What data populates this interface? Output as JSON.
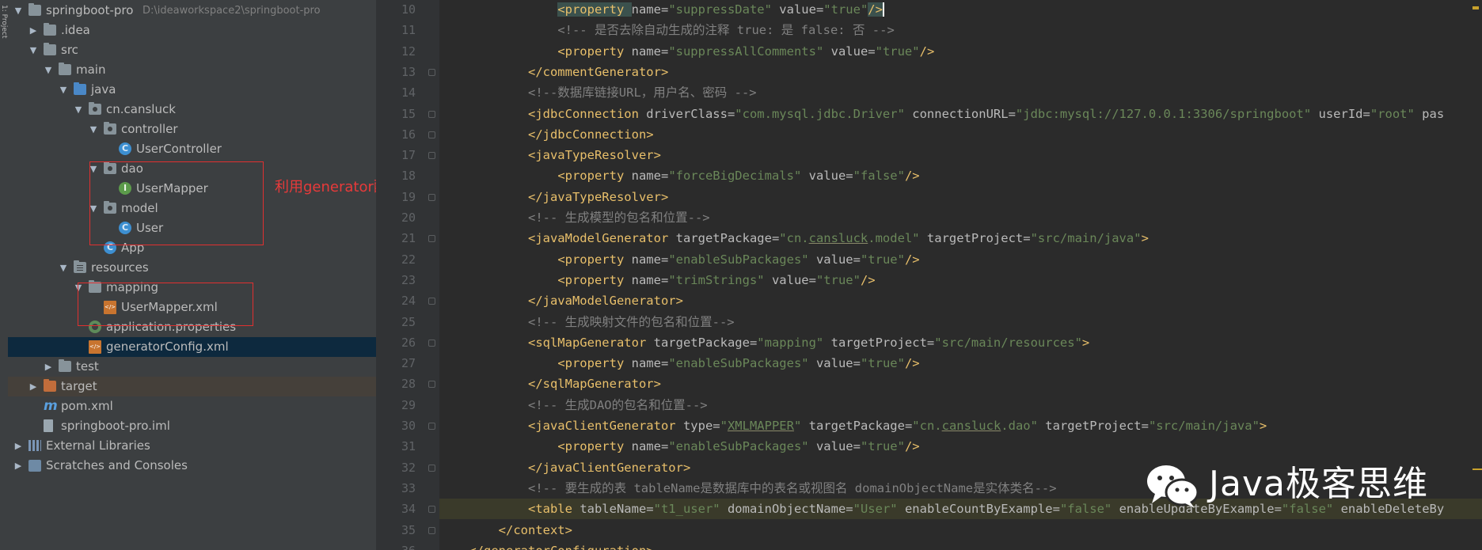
{
  "left_tool_tab": "1: Project",
  "project_tree": [
    {
      "label": "springboot-pro",
      "path": "D:\\ideaworkspace2\\springboot-pro",
      "icon": "project-folder-icon",
      "expanded": true
    },
    {
      "label": ".idea",
      "icon": "folder-icon",
      "expanded": false
    },
    {
      "label": "src",
      "icon": "folder-icon",
      "expanded": true
    },
    {
      "label": "main",
      "icon": "folder-icon",
      "expanded": true
    },
    {
      "label": "java",
      "icon": "source-folder-icon",
      "expanded": true
    },
    {
      "label": "cn.cansluck",
      "icon": "package-icon",
      "expanded": true
    },
    {
      "label": "controller",
      "icon": "package-icon",
      "expanded": true
    },
    {
      "label": "UserController",
      "icon": "class-icon"
    },
    {
      "label": "dao",
      "icon": "package-icon",
      "expanded": true
    },
    {
      "label": "UserMapper",
      "icon": "interface-icon"
    },
    {
      "label": "model",
      "icon": "package-icon",
      "expanded": true
    },
    {
      "label": "User",
      "icon": "class-icon"
    },
    {
      "label": "App",
      "icon": "springboot-class-icon"
    },
    {
      "label": "resources",
      "icon": "resources-folder-icon",
      "expanded": true
    },
    {
      "label": "mapping",
      "icon": "folder-icon",
      "expanded": true
    },
    {
      "label": "UserMapper.xml",
      "icon": "xml-file-icon"
    },
    {
      "label": "application.properties",
      "icon": "properties-file-icon"
    },
    {
      "label": "generatorConfig.xml",
      "icon": "xml-file-icon",
      "selected": true
    },
    {
      "label": "test",
      "icon": "folder-icon",
      "expanded": false
    },
    {
      "label": "target",
      "icon": "excluded-folder-icon",
      "expanded": false
    },
    {
      "label": "pom.xml",
      "icon": "maven-icon"
    },
    {
      "label": "springboot-pro.iml",
      "icon": "iml-file-icon"
    },
    {
      "label": "External Libraries",
      "icon": "library-icon",
      "expanded": false
    },
    {
      "label": "Scratches and Consoles",
      "icon": "scratches-icon",
      "expanded": false
    }
  ],
  "annotation": "利用generator配置反向生成",
  "line_numbers": [
    "10",
    "11",
    "12",
    "13",
    "14",
    "15",
    "16",
    "17",
    "18",
    "19",
    "20",
    "21",
    "22",
    "23",
    "24",
    "25",
    "26",
    "27",
    "28",
    "29",
    "30",
    "31",
    "32",
    "33",
    "34",
    "35",
    "36"
  ],
  "code_lines": [
    [
      [
        "",
        "                "
      ],
      [
        "tagbox",
        "<property "
      ],
      [
        "attr",
        "name="
      ],
      [
        "val",
        "\"suppressDate\""
      ],
      [
        "attr",
        " value="
      ],
      [
        "val",
        "\"true\""
      ],
      [
        "tagbox",
        "/>"
      ]
    ],
    [
      [
        "",
        "                "
      ],
      [
        "cmt",
        "<!-- 是否去除自动生成的注释 true: 是 false: 否 -->"
      ]
    ],
    [
      [
        "",
        "                "
      ],
      [
        "tag",
        "<property "
      ],
      [
        "attr",
        "name="
      ],
      [
        "val",
        "\"suppressAllComments\""
      ],
      [
        "attr",
        " value="
      ],
      [
        "val",
        "\"true\""
      ],
      [
        "tag",
        "/>"
      ]
    ],
    [
      [
        "",
        "            "
      ],
      [
        "tag",
        "</commentGenerator>"
      ]
    ],
    [
      [
        "",
        "            "
      ],
      [
        "cmt",
        "<!--数据库链接URL，用户名、密码 -->"
      ]
    ],
    [
      [
        "",
        "            "
      ],
      [
        "tag",
        "<jdbcConnection "
      ],
      [
        "attr",
        "driverClass="
      ],
      [
        "val",
        "\"com.mysql.jdbc.Driver\""
      ],
      [
        "attr",
        " connectionURL="
      ],
      [
        "val",
        "\"jdbc:mysql://127.0.0.1:3306/springboot\""
      ],
      [
        "attr",
        " userId="
      ],
      [
        "val",
        "\"root\""
      ],
      [
        "attr",
        " pas"
      ]
    ],
    [
      [
        "",
        "            "
      ],
      [
        "tag",
        "</jdbcConnection>"
      ]
    ],
    [
      [
        "",
        "            "
      ],
      [
        "tag",
        "<javaTypeResolver>"
      ]
    ],
    [
      [
        "",
        "                "
      ],
      [
        "tag",
        "<property "
      ],
      [
        "attr",
        "name="
      ],
      [
        "val",
        "\"forceBigDecimals\""
      ],
      [
        "attr",
        " value="
      ],
      [
        "val",
        "\"false\""
      ],
      [
        "tag",
        "/>"
      ]
    ],
    [
      [
        "",
        "            "
      ],
      [
        "tag",
        "</javaTypeResolver>"
      ]
    ],
    [
      [
        "",
        "            "
      ],
      [
        "cmt",
        "<!-- 生成模型的包名和位置-->"
      ]
    ],
    [
      [
        "",
        "            "
      ],
      [
        "tag",
        "<javaModelGenerator "
      ],
      [
        "attr",
        "targetPackage="
      ],
      [
        "val",
        "\"cn."
      ],
      [
        "val ul",
        "cansluck"
      ],
      [
        "val",
        ".model\""
      ],
      [
        "attr",
        " targetProject="
      ],
      [
        "val",
        "\"src/main/java\""
      ],
      [
        "tag",
        ">"
      ]
    ],
    [
      [
        "",
        "                "
      ],
      [
        "tag",
        "<property "
      ],
      [
        "attr",
        "name="
      ],
      [
        "val",
        "\"enableSubPackages\""
      ],
      [
        "attr",
        " value="
      ],
      [
        "val",
        "\"true\""
      ],
      [
        "tag",
        "/>"
      ]
    ],
    [
      [
        "",
        "                "
      ],
      [
        "tag",
        "<property "
      ],
      [
        "attr",
        "name="
      ],
      [
        "val",
        "\"trimStrings\""
      ],
      [
        "attr",
        " value="
      ],
      [
        "val",
        "\"true\""
      ],
      [
        "tag",
        "/>"
      ]
    ],
    [
      [
        "",
        "            "
      ],
      [
        "tag",
        "</javaModelGenerator>"
      ]
    ],
    [
      [
        "",
        "            "
      ],
      [
        "cmt",
        "<!-- 生成映射文件的包名和位置-->"
      ]
    ],
    [
      [
        "",
        "            "
      ],
      [
        "tag",
        "<sqlMapGenerator "
      ],
      [
        "attr",
        "targetPackage="
      ],
      [
        "val",
        "\"mapping\""
      ],
      [
        "attr",
        " targetProject="
      ],
      [
        "val",
        "\"src/main/resources\""
      ],
      [
        "tag",
        ">"
      ]
    ],
    [
      [
        "",
        "                "
      ],
      [
        "tag",
        "<property "
      ],
      [
        "attr",
        "name="
      ],
      [
        "val",
        "\"enableSubPackages\""
      ],
      [
        "attr",
        " value="
      ],
      [
        "val",
        "\"true\""
      ],
      [
        "tag",
        "/>"
      ]
    ],
    [
      [
        "",
        "            "
      ],
      [
        "tag",
        "</sqlMapGenerator>"
      ]
    ],
    [
      [
        "",
        "            "
      ],
      [
        "cmt",
        "<!-- 生成DAO的包名和位置-->"
      ]
    ],
    [
      [
        "",
        "            "
      ],
      [
        "tag",
        "<javaClientGenerator "
      ],
      [
        "attr",
        "type="
      ],
      [
        "val",
        "\""
      ],
      [
        "val ul",
        "XMLMAPPER"
      ],
      [
        "val",
        "\""
      ],
      [
        "attr",
        " targetPackage="
      ],
      [
        "val",
        "\"cn."
      ],
      [
        "val ul",
        "cansluck"
      ],
      [
        "val",
        ".dao\""
      ],
      [
        "attr",
        " targetProject="
      ],
      [
        "val",
        "\"src/main/java\""
      ],
      [
        "tag",
        ">"
      ]
    ],
    [
      [
        "",
        "                "
      ],
      [
        "tag",
        "<property "
      ],
      [
        "attr",
        "name="
      ],
      [
        "val",
        "\"enableSubPackages\""
      ],
      [
        "attr",
        " value="
      ],
      [
        "val",
        "\"true\""
      ],
      [
        "tag",
        "/>"
      ]
    ],
    [
      [
        "",
        "            "
      ],
      [
        "tag",
        "</javaClientGenerator>"
      ]
    ],
    [
      [
        "",
        "            "
      ],
      [
        "cmt",
        "<!-- 要生成的表 tableName是数据库中的表名或视图名 domainObjectName是实体类名-->"
      ]
    ],
    [
      [
        "",
        "            "
      ],
      [
        "tag",
        "<table "
      ],
      [
        "attr",
        "tableName="
      ],
      [
        "val",
        "\"t1_user\""
      ],
      [
        "attr",
        " domainObjectName="
      ],
      [
        "val",
        "\"User\""
      ],
      [
        "attr",
        " enableCountByExample="
      ],
      [
        "val",
        "\"false\""
      ],
      [
        "attr",
        " enableUpdateByExample="
      ],
      [
        "val",
        "\"false\""
      ],
      [
        "attr",
        " enableDeleteBy"
      ]
    ],
    [
      [
        "",
        "        "
      ],
      [
        "tag",
        "</context>"
      ]
    ],
    [
      [
        "",
        "    "
      ],
      [
        "tag",
        "</generatorConfiguration>"
      ]
    ]
  ],
  "watermark": {
    "text": "Java极客思维",
    "logo": "wechat-logo-icon"
  },
  "colors": {
    "tag": "#e8bf6a",
    "attr": "#bababa",
    "value": "#6a8759",
    "comment": "#808080",
    "annotation": "#e83a3a"
  }
}
